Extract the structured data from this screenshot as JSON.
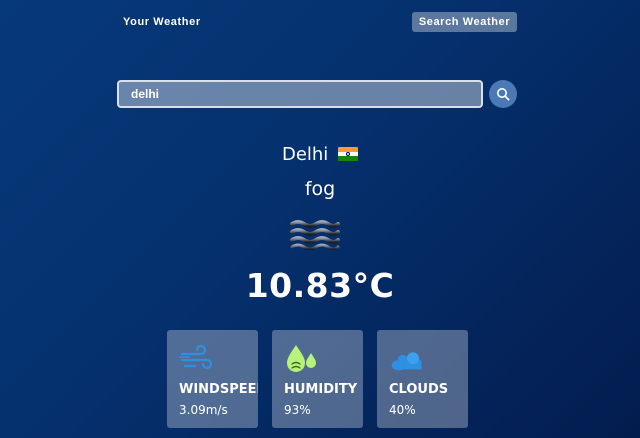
{
  "nav": {
    "your_weather": "Your Weather",
    "search_weather": "Search Weather"
  },
  "search": {
    "value": "delhi",
    "icon": "search-icon"
  },
  "weather": {
    "city": "Delhi",
    "flag": "india-flag-icon",
    "condition": "fog",
    "condition_icon": "fog-icon",
    "temperature": "10.83°C"
  },
  "cards": [
    {
      "label": "WINDSPEED",
      "value": "3.09m/s",
      "icon": "wind-icon"
    },
    {
      "label": "HUMIDITY",
      "value": "93%",
      "icon": "humidity-icon"
    },
    {
      "label": "CLOUDS",
      "value": "40%",
      "icon": "clouds-icon"
    }
  ],
  "colors": {
    "background_start": "#06397a",
    "background_end": "#031c4e",
    "search_button": "#4a79b6",
    "wind_icon": "#2f8fe0",
    "humidity_icon": "#b7f27a",
    "clouds_icon": "#2f8fe0"
  }
}
